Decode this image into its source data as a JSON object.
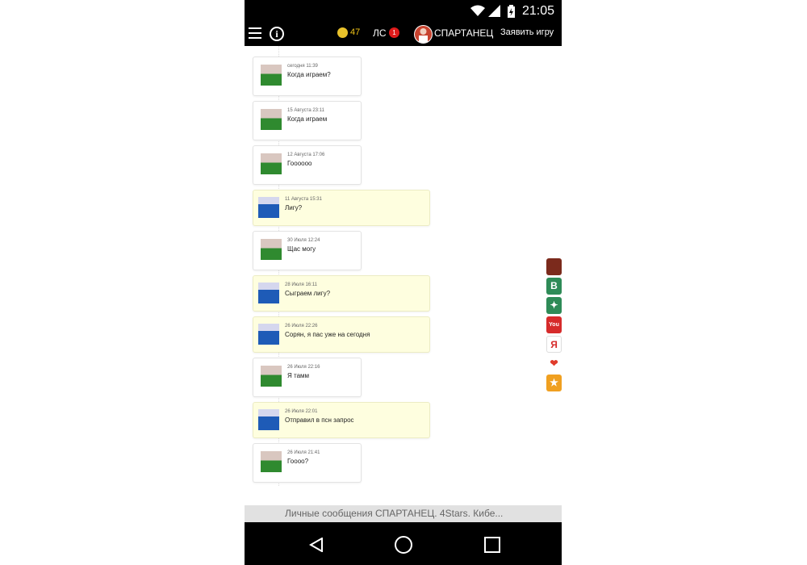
{
  "status_bar": {
    "time": "21:05"
  },
  "app_bar": {
    "coins": "47",
    "ls_label": "ЛС",
    "ls_badge": "1",
    "user_name": "СПАРТАНЕЦ",
    "create_game": "Заявить игру"
  },
  "messages": [
    {
      "date": "сегодня 11:39",
      "text": "Когда играем?",
      "from": "other"
    },
    {
      "date": "15 Августа 23:11",
      "text": "Когда играем",
      "from": "other"
    },
    {
      "date": "12 Августа 17:06",
      "text": "Гоооооо",
      "from": "other"
    },
    {
      "date": "11 Августа 15:31",
      "text": "Лигу?",
      "from": "self"
    },
    {
      "date": "30 Июля 12:24",
      "text": "Щас могу",
      "from": "other"
    },
    {
      "date": "28 Июля 16:11",
      "text": "Сыграем лигу?",
      "from": "self"
    },
    {
      "date": "26 Июля 22:26",
      "text": "Сорян, я пас уже на сегодня",
      "from": "self"
    },
    {
      "date": "26 Июля 22:16",
      "text": "Я тамм",
      "from": "other"
    },
    {
      "date": "26 Июля 22:01",
      "text": "Отправил в псн запрос",
      "from": "self"
    },
    {
      "date": "26 Июля 21:41",
      "text": "Гоооо?",
      "from": "other"
    }
  ],
  "social_bar": {
    "items": [
      {
        "icon": "cap-icon",
        "color": "#7b2a1c"
      },
      {
        "icon": "vk-icon",
        "label": "В",
        "color": "#2e8b57"
      },
      {
        "icon": "twitter-icon",
        "color": "#2e8b57"
      },
      {
        "icon": "youtube-icon",
        "label": "You",
        "color": "#d62b2b"
      },
      {
        "icon": "yandex-icon",
        "label": "Я",
        "color": "#ffffff"
      },
      {
        "icon": "heart-icon",
        "color": "#e03b2b"
      },
      {
        "icon": "star-icon",
        "color": "#f0a020"
      }
    ]
  },
  "page_title": "Личные сообщения СПАРТАНЕЦ. 4Stars. Кибе..."
}
